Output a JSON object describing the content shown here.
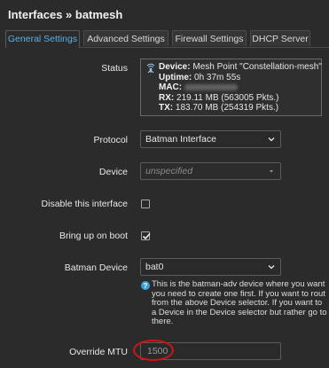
{
  "page": {
    "title": "Interfaces » batmesh"
  },
  "tabs": [
    {
      "label": "General Settings",
      "active": true
    },
    {
      "label": "Advanced Settings",
      "active": false
    },
    {
      "label": "Firewall Settings",
      "active": false
    },
    {
      "label": "DHCP Server",
      "active": false
    }
  ],
  "status": {
    "label": "Status",
    "icon": "mesh-point-icon",
    "device_key": "Device:",
    "device_value": "Mesh Point \"Constellation-mesh\"",
    "uptime_key": "Uptime:",
    "uptime_value": "0h 37m 55s",
    "mac_key": "MAC:",
    "mac_redacted": true,
    "rx_key": "RX:",
    "rx_value": "219.11 MB (563005 Pkts.)",
    "tx_key": "TX:",
    "tx_value": "183.70 MB (254319 Pkts.)"
  },
  "protocol": {
    "label": "Protocol",
    "value": "Batman Interface"
  },
  "device": {
    "label": "Device",
    "value": "unspecified"
  },
  "disable_interface": {
    "label": "Disable this interface",
    "checked": false
  },
  "bring_up_on_boot": {
    "label": "Bring up on boot",
    "checked": true
  },
  "batman_device": {
    "label": "Batman Device",
    "value": "bat0",
    "help_lines": [
      "This is the batman-adv device where you want",
      "you need to create one first. If you want to rout",
      "from the above Device selector. If you want to",
      "a Device in the Device selector but rather go to",
      "there."
    ]
  },
  "override_mtu": {
    "label": "Override MTU",
    "value": "1500"
  },
  "colors": {
    "background": "#2b2b2b",
    "accent": "#5ab0e8",
    "highlight_circle": "#d01414"
  }
}
